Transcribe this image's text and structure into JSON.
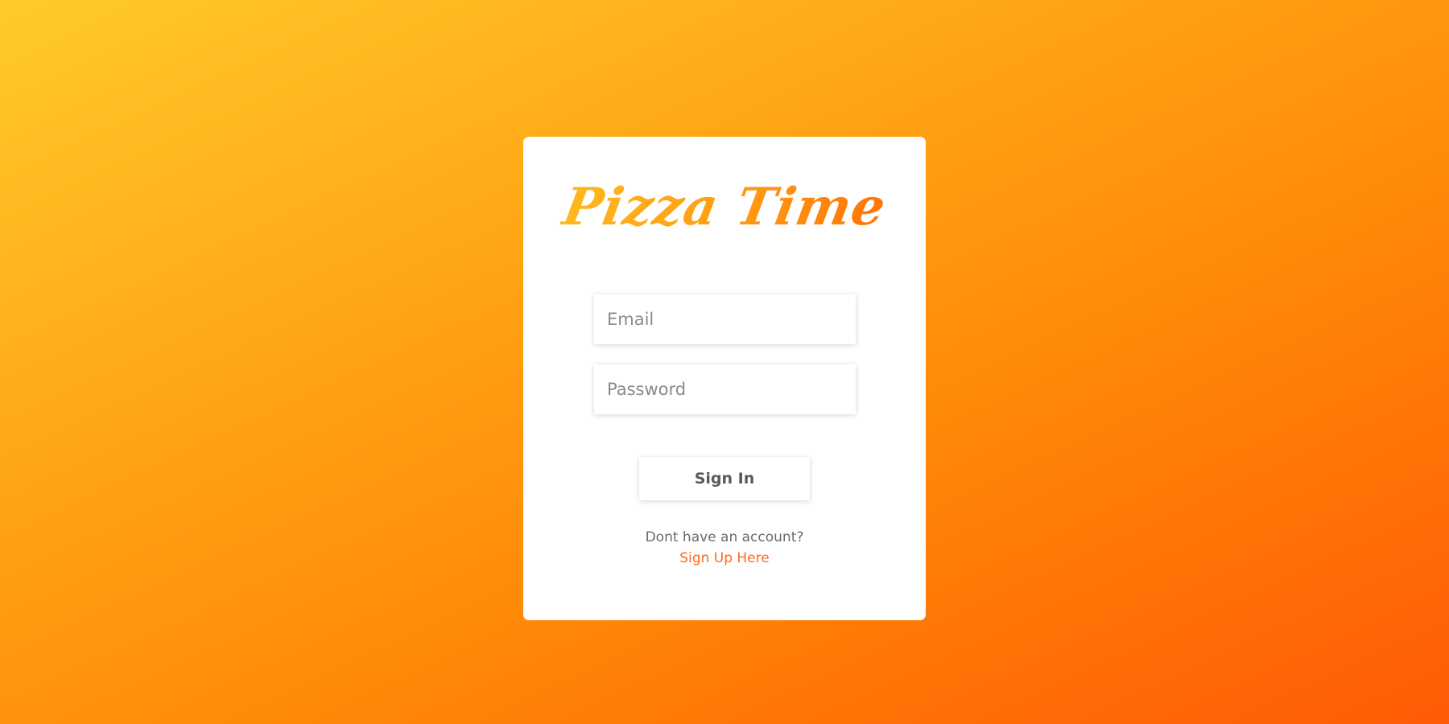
{
  "brand": {
    "title": "Pizza Time"
  },
  "form": {
    "email_placeholder": "Email",
    "password_placeholder": "Password",
    "submit_label": "Sign In"
  },
  "footer": {
    "prompt": "Dont have an account?",
    "signup_link": "Sign Up Here"
  },
  "colors": {
    "gradient_start": "#ffcb2b",
    "gradient_end": "#ff5a05",
    "link": "#ff6a1a"
  }
}
